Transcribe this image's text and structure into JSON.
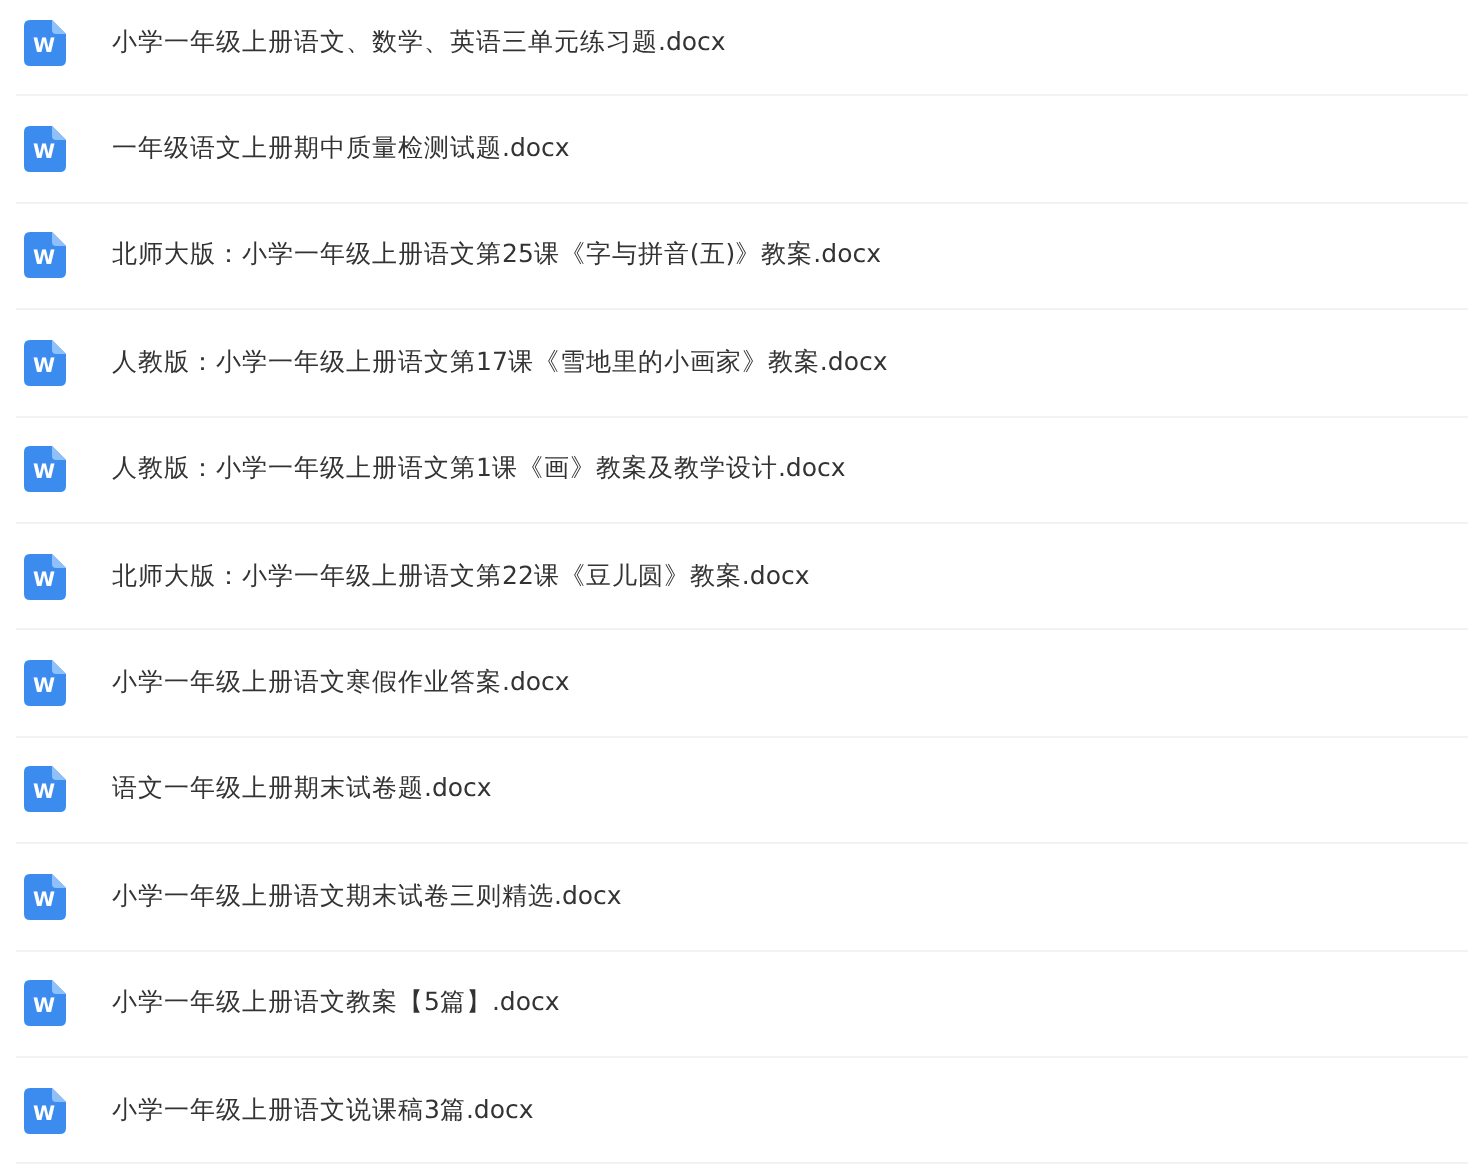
{
  "files": [
    {
      "icon_letter": "W",
      "name": "小学一年级上册语文、数学、英语三单元练习题.docx"
    },
    {
      "icon_letter": "W",
      "name": "一年级语文上册期中质量检测试题.docx"
    },
    {
      "icon_letter": "W",
      "name": "北师大版：小学一年级上册语文第25课《字与拼音(五)》教案.docx"
    },
    {
      "icon_letter": "W",
      "name": "人教版：小学一年级上册语文第17课《雪地里的小画家》教案.docx"
    },
    {
      "icon_letter": "W",
      "name": "人教版：小学一年级上册语文第1课《画》教案及教学设计.docx"
    },
    {
      "icon_letter": "W",
      "name": "北师大版：小学一年级上册语文第22课《豆儿圆》教案.docx"
    },
    {
      "icon_letter": "W",
      "name": "小学一年级上册语文寒假作业答案.docx"
    },
    {
      "icon_letter": "W",
      "name": "语文一年级上册期末试卷题.docx"
    },
    {
      "icon_letter": "W",
      "name": "小学一年级上册语文期末试卷三则精选.docx"
    },
    {
      "icon_letter": "W",
      "name": "小学一年级上册语文教案【5篇】.docx"
    },
    {
      "icon_letter": "W",
      "name": "小学一年级上册语文说课稿3篇.docx"
    }
  ]
}
